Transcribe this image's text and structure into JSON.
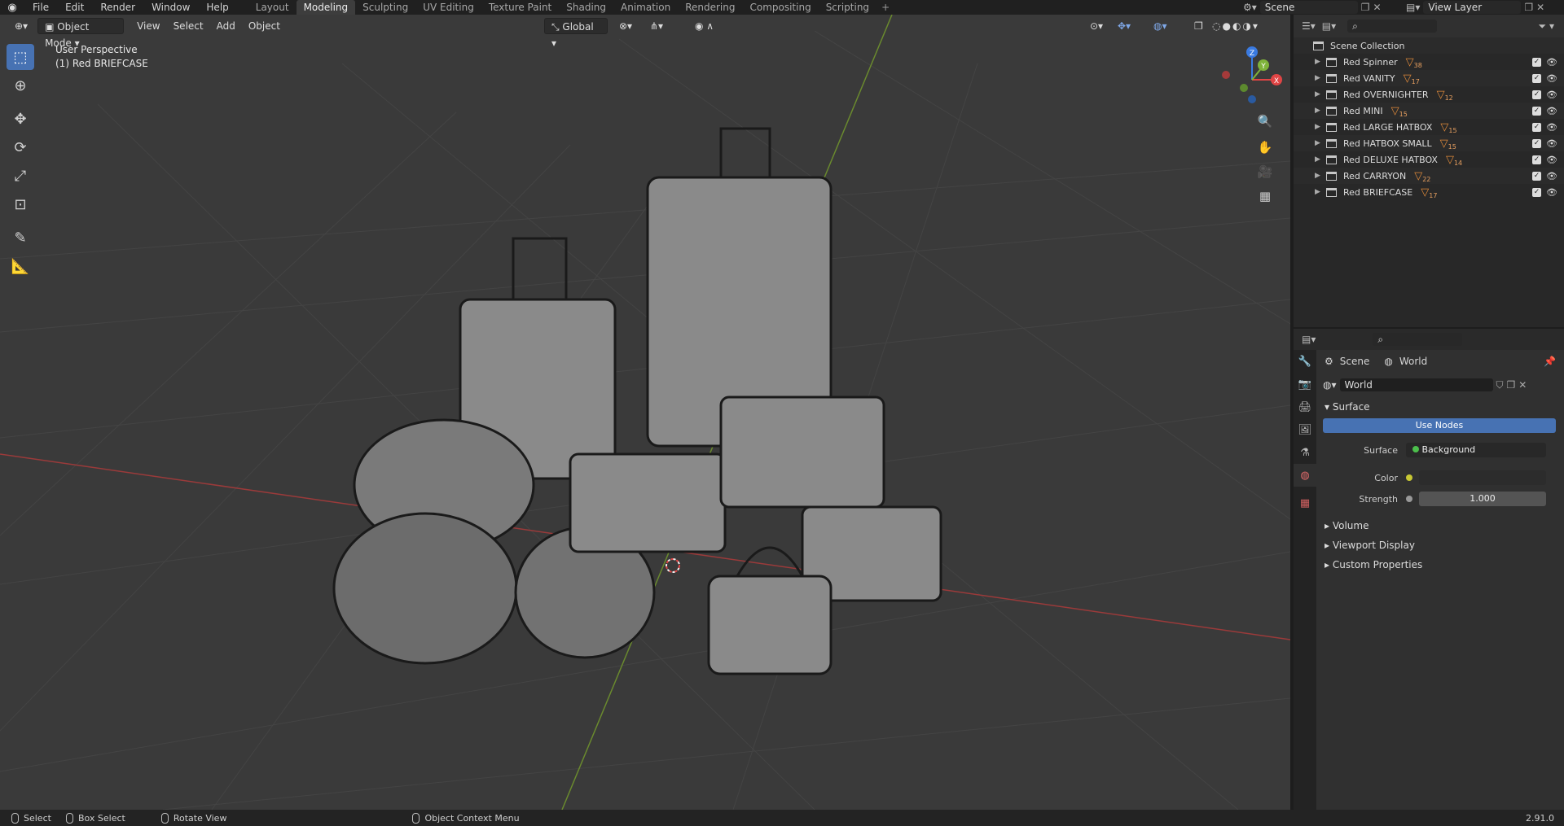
{
  "topbar": {
    "menus": [
      "File",
      "Edit",
      "Render",
      "Window",
      "Help"
    ],
    "workspaces": [
      "Layout",
      "Modeling",
      "Sculpting",
      "UV Editing",
      "Texture Paint",
      "Shading",
      "Animation",
      "Rendering",
      "Compositing",
      "Scripting"
    ],
    "active_workspace": "Modeling",
    "scene_label": "Scene",
    "view_layer_label": "View Layer"
  },
  "viewport": {
    "mode": "Object Mode",
    "menus": [
      "View",
      "Select",
      "Add",
      "Object"
    ],
    "orientation": "Global",
    "perspective": "User Perspective",
    "active_object": "(1) Red  BRIEFCASE",
    "gizmo": {
      "x": "X",
      "y": "Y",
      "z": "Z"
    }
  },
  "outliner": {
    "root": "Scene Collection",
    "items": [
      {
        "name": "Red  Spinner",
        "count": "38"
      },
      {
        "name": "Red  VANITY",
        "count": "17"
      },
      {
        "name": "Red  OVERNIGHTER",
        "count": "12"
      },
      {
        "name": "Red MINI",
        "count": "15"
      },
      {
        "name": "Red LARGE HATBOX",
        "count": "15"
      },
      {
        "name": "Red  HATBOX SMALL",
        "count": "15"
      },
      {
        "name": "Red  DELUXE HATBOX",
        "count": "14"
      },
      {
        "name": "Red  CARRYON",
        "count": "22"
      },
      {
        "name": "Red  BRIEFCASE",
        "count": "17"
      }
    ]
  },
  "properties": {
    "breadcrumb_scene": "Scene",
    "breadcrumb_world": "World",
    "world_name": "World",
    "surface_panel": "Surface",
    "use_nodes": "Use Nodes",
    "surface_label": "Surface",
    "surface_value": "Background",
    "color_label": "Color",
    "strength_label": "Strength",
    "strength_value": "1.000",
    "panels": [
      "Volume",
      "Viewport Display",
      "Custom Properties"
    ]
  },
  "statusbar": {
    "select": "Select",
    "box_select": "Box Select",
    "rotate": "Rotate View",
    "context_menu": "Object Context Menu",
    "version": "2.91.0"
  },
  "colors": {
    "accent": "#4772b3",
    "x_axis": "#e04545",
    "y_axis": "#7fb33a",
    "z_axis": "#3a7ae0",
    "grid_bg": "#3a3a3a"
  }
}
